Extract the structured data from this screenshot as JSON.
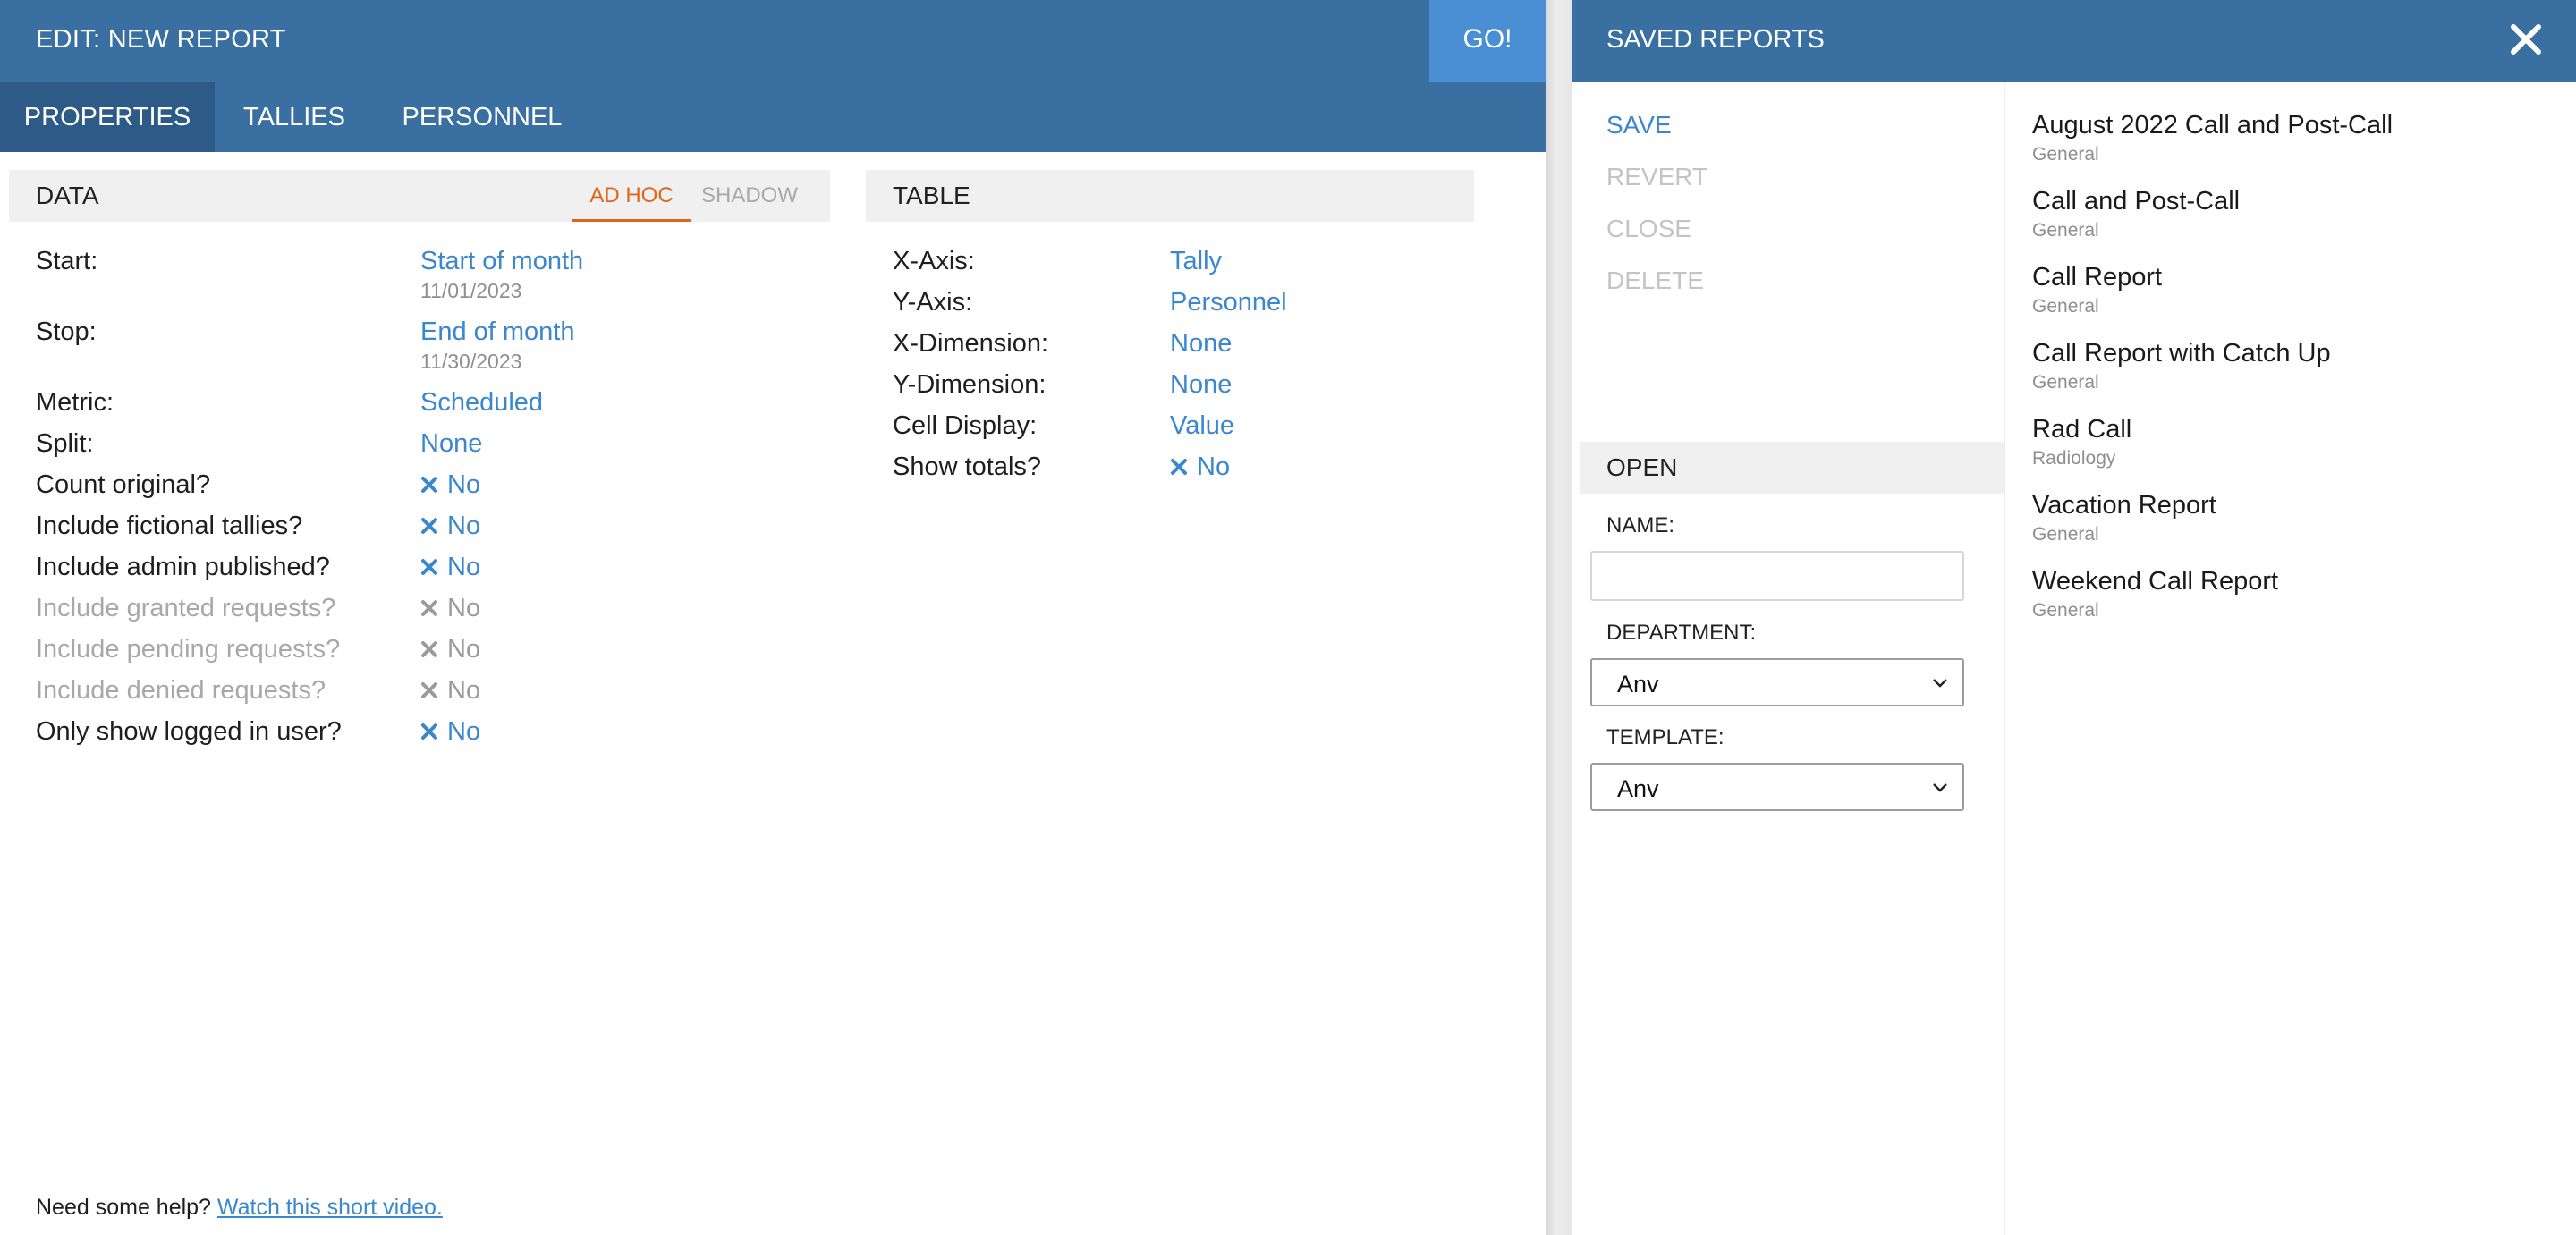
{
  "editor": {
    "title": "EDIT: NEW REPORT",
    "go_label": "GO!",
    "tabs": [
      {
        "label": "PROPERTIES",
        "active": true
      },
      {
        "label": "TALLIES",
        "active": false
      },
      {
        "label": "PERSONNEL",
        "active": false
      }
    ],
    "data_section": {
      "title": "DATA",
      "modes": [
        {
          "label": "AD HOC",
          "active": true
        },
        {
          "label": "SHADOW",
          "active": false
        }
      ],
      "rows": [
        {
          "label": "Start:",
          "value": "Start of month",
          "sub": "11/01/2023",
          "enabled": true
        },
        {
          "label": "Stop:",
          "value": "End of month",
          "sub": "11/30/2023",
          "enabled": true
        },
        {
          "label": "Metric:",
          "value": "Scheduled",
          "enabled": true
        },
        {
          "label": "Split:",
          "value": "None",
          "enabled": true
        },
        {
          "label": "Count original?",
          "value": "No",
          "icon": "x-icon",
          "enabled": true
        },
        {
          "label": "Include fictional tallies?",
          "value": "No",
          "icon": "x-icon",
          "enabled": true
        },
        {
          "label": "Include admin published?",
          "value": "No",
          "icon": "x-icon",
          "enabled": true
        },
        {
          "label": "Include granted requests?",
          "value": "No",
          "icon": "x-icon",
          "enabled": false
        },
        {
          "label": "Include pending requests?",
          "value": "No",
          "icon": "x-icon",
          "enabled": false
        },
        {
          "label": "Include denied requests?",
          "value": "No",
          "icon": "x-icon",
          "enabled": false
        },
        {
          "label": "Only show logged in user?",
          "value": "No",
          "icon": "x-icon",
          "enabled": true
        }
      ]
    },
    "table_section": {
      "title": "TABLE",
      "rows": [
        {
          "label": "X-Axis:",
          "value": "Tally"
        },
        {
          "label": "Y-Axis:",
          "value": "Personnel"
        },
        {
          "label": "X-Dimension:",
          "value": "None"
        },
        {
          "label": "Y-Dimension:",
          "value": "None"
        },
        {
          "label": "Cell Display:",
          "value": "Value"
        },
        {
          "label": "Show totals?",
          "value": "No",
          "icon": "x-icon"
        }
      ]
    },
    "help": {
      "text": "Need some help?",
      "link": "Watch this short video."
    }
  },
  "saved": {
    "title": "SAVED REPORTS",
    "actions": [
      {
        "label": "SAVE",
        "enabled": true
      },
      {
        "label": "REVERT",
        "enabled": false
      },
      {
        "label": "CLOSE",
        "enabled": false
      },
      {
        "label": "DELETE",
        "enabled": false
      }
    ],
    "open": {
      "title": "OPEN",
      "name_label": "NAME:",
      "name_value": "",
      "department_label": "DEPARTMENT:",
      "department_value": "Anv",
      "template_label": "TEMPLATE:",
      "template_value": "Anv"
    },
    "reports": [
      {
        "name": "August 2022 Call and Post-Call",
        "dept": "General"
      },
      {
        "name": "Call and Post-Call",
        "dept": "General"
      },
      {
        "name": "Call Report",
        "dept": "General"
      },
      {
        "name": "Call Report with Catch Up",
        "dept": "General"
      },
      {
        "name": "Rad Call",
        "dept": "Radiology"
      },
      {
        "name": "Vacation Report",
        "dept": "General"
      },
      {
        "name": "Weekend Call Report",
        "dept": "General"
      }
    ],
    "colors": {
      "header": "#3a6fa1",
      "accent": "#3a86cf",
      "active_mode": "#e2661a"
    }
  }
}
